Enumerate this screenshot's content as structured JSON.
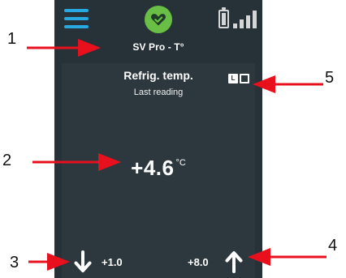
{
  "header": {
    "menu_icon": "hamburger-menu-icon",
    "status_icon": "check-heart-icon",
    "battery_icon": "battery-icon",
    "signal_icon": "signal-bars-icon"
  },
  "device": {
    "label": "SV Pro - T°"
  },
  "reading_panel": {
    "title": "Refrig. temp.",
    "subtitle": "Last reading",
    "mode_icon_left": "L",
    "value": "+4.6",
    "unit": "°C"
  },
  "thresholds": {
    "min_value": "+1.0",
    "max_value": "+8.0"
  },
  "callouts": [
    "1",
    "2",
    "3",
    "4",
    "5"
  ],
  "colors": {
    "device_bg": "#263238",
    "panel_bg": "#2d383e",
    "menu_blue": "#28a8e0",
    "status_green": "#69bf45",
    "callout_red": "#e8101d"
  }
}
